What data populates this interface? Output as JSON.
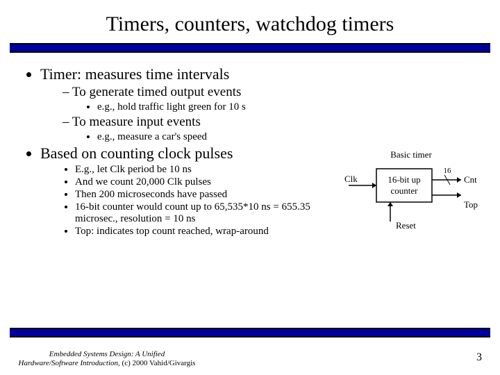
{
  "title": "Timers, counters, watchdog timers",
  "bullets": {
    "b1a": "Timer: measures time intervals",
    "b2a": "To generate timed output events",
    "b3a": "e.g., hold traffic light green for 10 s",
    "b2b": "To measure input events",
    "b3b": "e.g., measure a car's speed",
    "b1b": "Based on counting clock pulses",
    "b3c": "E.g., let Clk period be 10 ns",
    "b3d": "And we count 20,000 Clk pulses",
    "b3e": "Then 200 microseconds have passed",
    "b3f": "16-bit counter would count up to 65,535*10 ns = 655.35 microsec., resolution = 10 ns",
    "b3g": "Top: indicates top count reached, wrap-around"
  },
  "diagram": {
    "title": "Basic timer",
    "clk": "Clk",
    "box_line1": "16-bit up",
    "box_line2": "counter",
    "cnt_width": "16",
    "cnt": "Cnt",
    "top": "Top",
    "reset": "Reset"
  },
  "footer": {
    "line1": "Embedded Systems Design: A Unified",
    "line2_a": "Hardware/Software Introduction,",
    "line2_b": " (c) 2000 Vahid/Givargis"
  },
  "page": "3"
}
